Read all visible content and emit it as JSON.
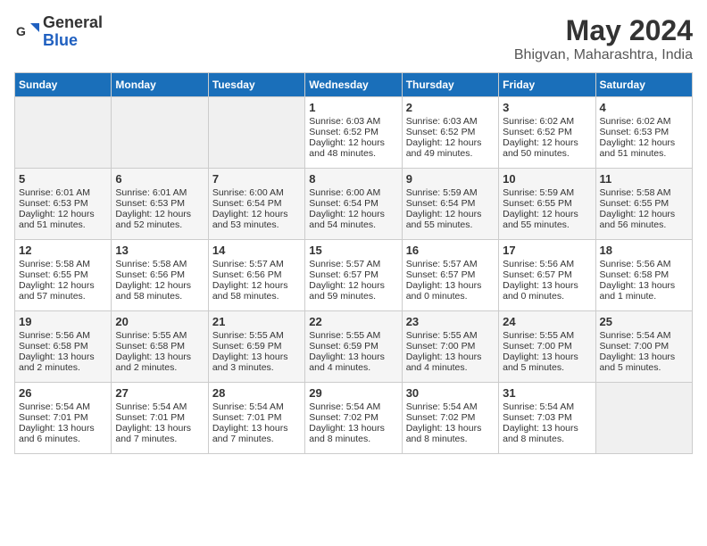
{
  "logo": {
    "general": "General",
    "blue": "Blue"
  },
  "title": "May 2024",
  "location": "Bhigvan, Maharashtra, India",
  "days_of_week": [
    "Sunday",
    "Monday",
    "Tuesday",
    "Wednesday",
    "Thursday",
    "Friday",
    "Saturday"
  ],
  "weeks": [
    [
      {
        "day": "",
        "sunrise": "",
        "sunset": "",
        "daylight": ""
      },
      {
        "day": "",
        "sunrise": "",
        "sunset": "",
        "daylight": ""
      },
      {
        "day": "",
        "sunrise": "",
        "sunset": "",
        "daylight": ""
      },
      {
        "day": "1",
        "sunrise": "Sunrise: 6:03 AM",
        "sunset": "Sunset: 6:52 PM",
        "daylight": "Daylight: 12 hours and 48 minutes."
      },
      {
        "day": "2",
        "sunrise": "Sunrise: 6:03 AM",
        "sunset": "Sunset: 6:52 PM",
        "daylight": "Daylight: 12 hours and 49 minutes."
      },
      {
        "day": "3",
        "sunrise": "Sunrise: 6:02 AM",
        "sunset": "Sunset: 6:52 PM",
        "daylight": "Daylight: 12 hours and 50 minutes."
      },
      {
        "day": "4",
        "sunrise": "Sunrise: 6:02 AM",
        "sunset": "Sunset: 6:53 PM",
        "daylight": "Daylight: 12 hours and 51 minutes."
      }
    ],
    [
      {
        "day": "5",
        "sunrise": "Sunrise: 6:01 AM",
        "sunset": "Sunset: 6:53 PM",
        "daylight": "Daylight: 12 hours and 51 minutes."
      },
      {
        "day": "6",
        "sunrise": "Sunrise: 6:01 AM",
        "sunset": "Sunset: 6:53 PM",
        "daylight": "Daylight: 12 hours and 52 minutes."
      },
      {
        "day": "7",
        "sunrise": "Sunrise: 6:00 AM",
        "sunset": "Sunset: 6:54 PM",
        "daylight": "Daylight: 12 hours and 53 minutes."
      },
      {
        "day": "8",
        "sunrise": "Sunrise: 6:00 AM",
        "sunset": "Sunset: 6:54 PM",
        "daylight": "Daylight: 12 hours and 54 minutes."
      },
      {
        "day": "9",
        "sunrise": "Sunrise: 5:59 AM",
        "sunset": "Sunset: 6:54 PM",
        "daylight": "Daylight: 12 hours and 55 minutes."
      },
      {
        "day": "10",
        "sunrise": "Sunrise: 5:59 AM",
        "sunset": "Sunset: 6:55 PM",
        "daylight": "Daylight: 12 hours and 55 minutes."
      },
      {
        "day": "11",
        "sunrise": "Sunrise: 5:58 AM",
        "sunset": "Sunset: 6:55 PM",
        "daylight": "Daylight: 12 hours and 56 minutes."
      }
    ],
    [
      {
        "day": "12",
        "sunrise": "Sunrise: 5:58 AM",
        "sunset": "Sunset: 6:55 PM",
        "daylight": "Daylight: 12 hours and 57 minutes."
      },
      {
        "day": "13",
        "sunrise": "Sunrise: 5:58 AM",
        "sunset": "Sunset: 6:56 PM",
        "daylight": "Daylight: 12 hours and 58 minutes."
      },
      {
        "day": "14",
        "sunrise": "Sunrise: 5:57 AM",
        "sunset": "Sunset: 6:56 PM",
        "daylight": "Daylight: 12 hours and 58 minutes."
      },
      {
        "day": "15",
        "sunrise": "Sunrise: 5:57 AM",
        "sunset": "Sunset: 6:57 PM",
        "daylight": "Daylight: 12 hours and 59 minutes."
      },
      {
        "day": "16",
        "sunrise": "Sunrise: 5:57 AM",
        "sunset": "Sunset: 6:57 PM",
        "daylight": "Daylight: 13 hours and 0 minutes."
      },
      {
        "day": "17",
        "sunrise": "Sunrise: 5:56 AM",
        "sunset": "Sunset: 6:57 PM",
        "daylight": "Daylight: 13 hours and 0 minutes."
      },
      {
        "day": "18",
        "sunrise": "Sunrise: 5:56 AM",
        "sunset": "Sunset: 6:58 PM",
        "daylight": "Daylight: 13 hours and 1 minute."
      }
    ],
    [
      {
        "day": "19",
        "sunrise": "Sunrise: 5:56 AM",
        "sunset": "Sunset: 6:58 PM",
        "daylight": "Daylight: 13 hours and 2 minutes."
      },
      {
        "day": "20",
        "sunrise": "Sunrise: 5:55 AM",
        "sunset": "Sunset: 6:58 PM",
        "daylight": "Daylight: 13 hours and 2 minutes."
      },
      {
        "day": "21",
        "sunrise": "Sunrise: 5:55 AM",
        "sunset": "Sunset: 6:59 PM",
        "daylight": "Daylight: 13 hours and 3 minutes."
      },
      {
        "day": "22",
        "sunrise": "Sunrise: 5:55 AM",
        "sunset": "Sunset: 6:59 PM",
        "daylight": "Daylight: 13 hours and 4 minutes."
      },
      {
        "day": "23",
        "sunrise": "Sunrise: 5:55 AM",
        "sunset": "Sunset: 7:00 PM",
        "daylight": "Daylight: 13 hours and 4 minutes."
      },
      {
        "day": "24",
        "sunrise": "Sunrise: 5:55 AM",
        "sunset": "Sunset: 7:00 PM",
        "daylight": "Daylight: 13 hours and 5 minutes."
      },
      {
        "day": "25",
        "sunrise": "Sunrise: 5:54 AM",
        "sunset": "Sunset: 7:00 PM",
        "daylight": "Daylight: 13 hours and 5 minutes."
      }
    ],
    [
      {
        "day": "26",
        "sunrise": "Sunrise: 5:54 AM",
        "sunset": "Sunset: 7:01 PM",
        "daylight": "Daylight: 13 hours and 6 minutes."
      },
      {
        "day": "27",
        "sunrise": "Sunrise: 5:54 AM",
        "sunset": "Sunset: 7:01 PM",
        "daylight": "Daylight: 13 hours and 7 minutes."
      },
      {
        "day": "28",
        "sunrise": "Sunrise: 5:54 AM",
        "sunset": "Sunset: 7:01 PM",
        "daylight": "Daylight: 13 hours and 7 minutes."
      },
      {
        "day": "29",
        "sunrise": "Sunrise: 5:54 AM",
        "sunset": "Sunset: 7:02 PM",
        "daylight": "Daylight: 13 hours and 8 minutes."
      },
      {
        "day": "30",
        "sunrise": "Sunrise: 5:54 AM",
        "sunset": "Sunset: 7:02 PM",
        "daylight": "Daylight: 13 hours and 8 minutes."
      },
      {
        "day": "31",
        "sunrise": "Sunrise: 5:54 AM",
        "sunset": "Sunset: 7:03 PM",
        "daylight": "Daylight: 13 hours and 8 minutes."
      },
      {
        "day": "",
        "sunrise": "",
        "sunset": "",
        "daylight": ""
      }
    ]
  ]
}
